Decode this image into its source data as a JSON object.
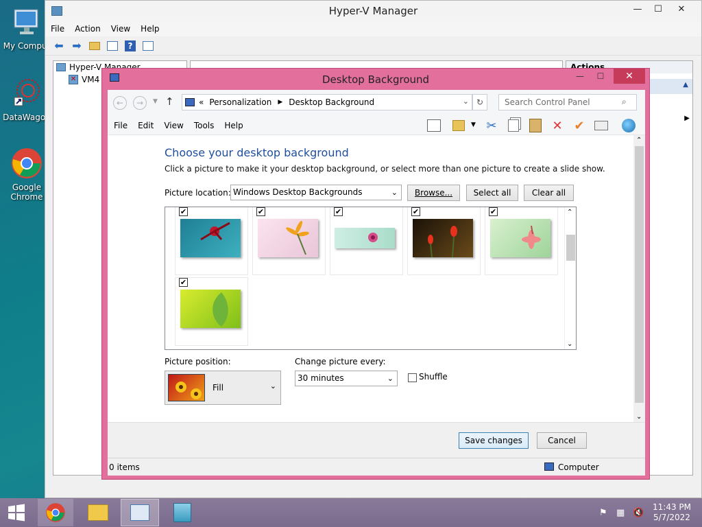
{
  "desktop": {
    "icons": [
      {
        "label": "My Comput"
      },
      {
        "label": "DataWagon"
      },
      {
        "label": "Google Chrome"
      }
    ]
  },
  "hyperv": {
    "title": "Hyper-V Manager",
    "menu": [
      "File",
      "Action",
      "View",
      "Help"
    ],
    "tree": {
      "root": "Hyper-V Manager",
      "child": "VM4"
    },
    "actions_header": "Actions"
  },
  "dialog": {
    "title": "Desktop Background",
    "breadcrumb_sep": "«",
    "breadcrumb": [
      "Personalization",
      "Desktop Background"
    ],
    "search_placeholder": "Search Control Panel",
    "menu": [
      "File",
      "Edit",
      "View",
      "Tools",
      "Help"
    ],
    "heading": "Choose your desktop background",
    "description": "Click a picture to make it your desktop background, or select more than one picture to create a slide show.",
    "picture_location_label": "Picture location:",
    "picture_location_value": "Windows Desktop Backgrounds",
    "browse_label": "Browse...",
    "select_all_label": "Select all",
    "clear_all_label": "Clear all",
    "pictures": [
      {
        "checked": true,
        "color": "#2e8fa0"
      },
      {
        "checked": true,
        "color": "#f2d6e4"
      },
      {
        "checked": true,
        "color": "#bfe3d9"
      },
      {
        "checked": true,
        "color": "#3a2a1a"
      },
      {
        "checked": true,
        "color": "#b9e2b0"
      },
      {
        "checked": true,
        "color": "#b6d629"
      }
    ],
    "picture_position_label": "Picture position:",
    "picture_position_value": "Fill",
    "change_every_label": "Change picture every:",
    "change_every_value": "30 minutes",
    "shuffle_label": "Shuffle",
    "shuffle_checked": false,
    "save_label": "Save changes",
    "cancel_label": "Cancel",
    "status_items": "0 items",
    "status_zone": "Computer"
  },
  "taskbar": {
    "time": "11:43 PM",
    "date": "5/7/2022"
  },
  "colors": {
    "dialog_frame": "#e3709c",
    "heading": "#1e4e9c",
    "close_red": "#c73b5a"
  }
}
